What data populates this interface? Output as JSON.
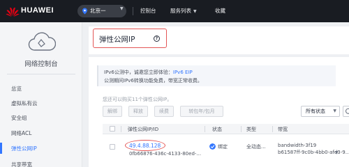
{
  "topbar": {
    "brand": "HUAWEI",
    "region": "北京一",
    "nav": [
      "控制台",
      "服务列表",
      "收藏"
    ]
  },
  "sidebar": {
    "title": "网络控制台",
    "items": [
      "总览",
      "虚拟私有云",
      "安全组",
      "网络ACL",
      "弹性公网IP",
      "共享带宽"
    ],
    "active_index": 4
  },
  "main": {
    "page_title": "弹性公网IP",
    "notice": {
      "line1_prefix": "IPv6公测中，诚邀您立即体验：",
      "line1_link": "IPv6 EIP",
      "line2": "公测期间IPv6转换功能免费，带宽正常收费。"
    },
    "quota_text": "您还可以购买11个弹性公网IP。",
    "buttons": [
      "解绑",
      "释放",
      "续费",
      "转包年/包月"
    ],
    "status_filter": "所有状态",
    "table": {
      "headers": [
        "弹性公网IP/ID",
        "状态",
        "类型",
        "带宽"
      ],
      "rows": [
        {
          "ip": "49.4.88.128",
          "id": "0fb66876-436c-4133-80ed-...",
          "status": "绑定",
          "type": "全动态...",
          "bandwidth_name": "bandwidth-3f19",
          "bandwidth_id": "b61587ff-9c0b-4bb0-afd3-9..."
        }
      ]
    }
  },
  "colors": {
    "topbar_bg": "#191c22",
    "accent": "#3377ff",
    "highlight": "#e35555",
    "brand_red": "#e60012"
  }
}
